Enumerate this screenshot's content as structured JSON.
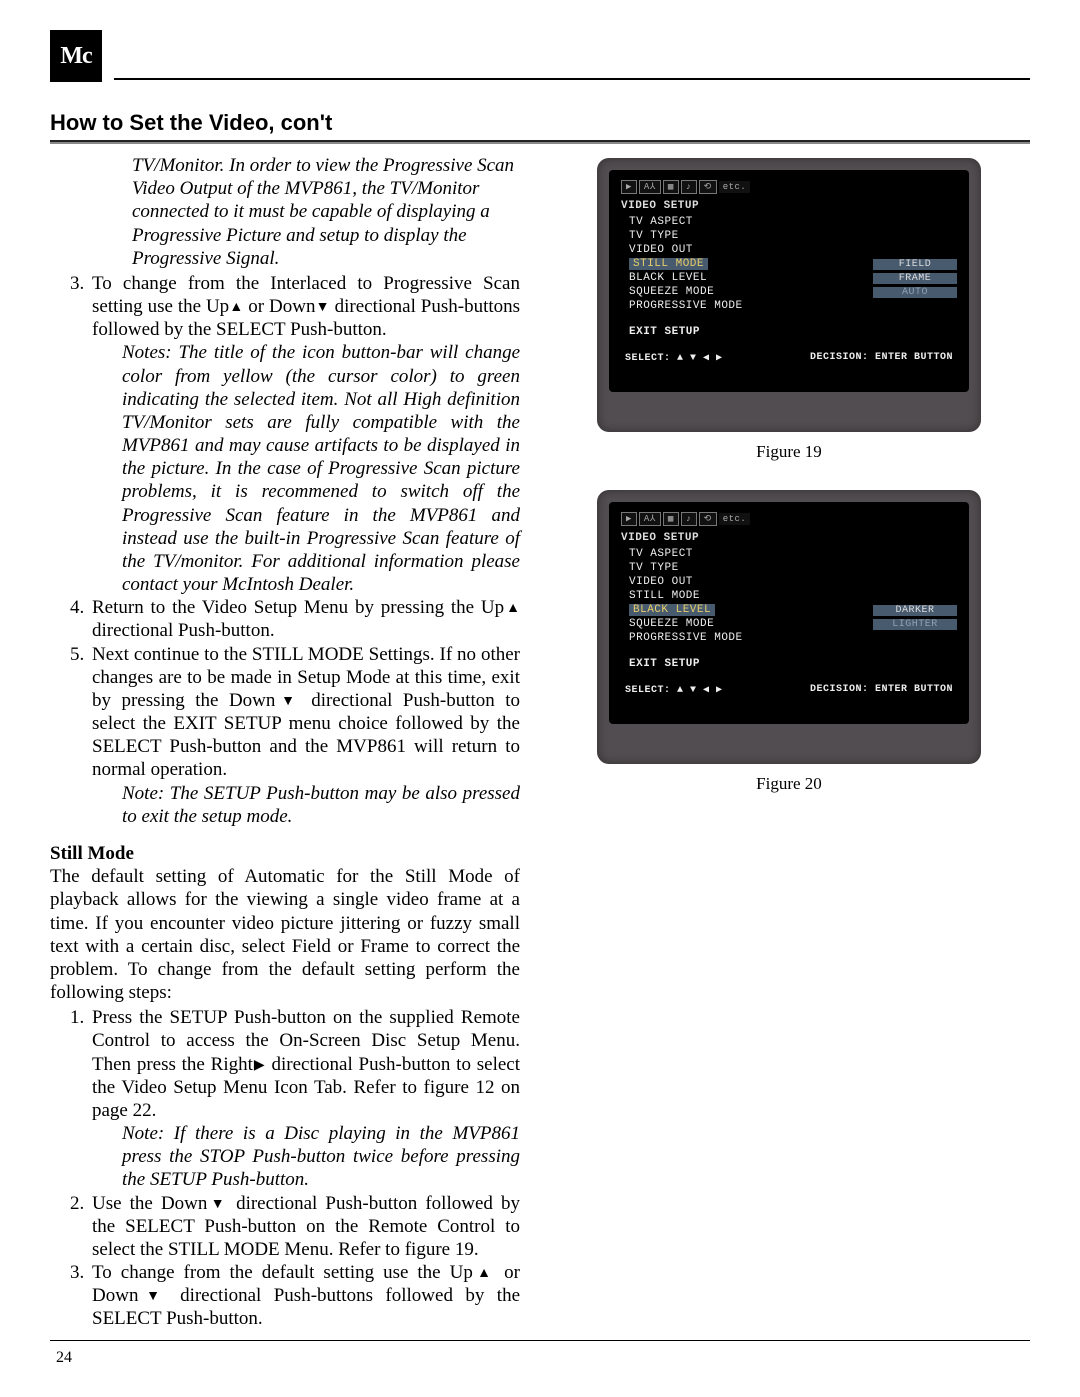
{
  "header": {
    "logo_text": "Mc"
  },
  "section_title": "How to Set the Video, con't",
  "intro_note": "TV/Monitor. In order to view the Progressive Scan Video Output of the MVP861, the TV/Monitor connected to it must be capable of displaying a Progressive Picture and setup to display the Progressive Signal.",
  "step3_num": "3.",
  "step3_body_a": "To change from the Interlaced to Progressive Scan setting use the Up",
  "step3_body_b": " or Down",
  "step3_body_c": " directional Push-buttons followed by the SELECT Push-button.",
  "step3_notes_label": "Notes:",
  "step3_notes_body": " The title of the icon button-bar will change color from yellow (the cursor color) to green indicating the selected item. Not all High definition TV/Monitor sets are fully compatible with the MVP861 and may cause artifacts to be displayed in the picture. In the case of Progressive Scan picture problems, it is recommened to switch off the Progressive Scan feature in the MVP861 and instead use the built-in Progressive Scan feature of the TV/monitor. For additional information please contact your McIntosh Dealer.",
  "step4_num": "4.",
  "step4_body_a": "Return to the Video Setup Menu by pressing the Up",
  "step4_body_b": " directional Push-button.",
  "step5_num": "5.",
  "step5_body_a": "Next continue to the STILL MODE Settings. If no other changes are to be made in Setup Mode at this time, exit by pressing the Down",
  "step5_body_b": " directional Push-button to select the EXIT SETUP menu choice followed by the SELECT Push-button and the MVP861 will return to normal operation.",
  "step5_note_label": "Note:",
  "step5_note_body": " The SETUP Push-button may be also pressed to exit the setup mode.",
  "still_mode_heading": "Still Mode",
  "still_mode_intro": "The default setting of Automatic for the Still Mode of playback allows for the viewing a single video frame at a time. If you encounter video picture jittering or fuzzy small text with a certain disc, select Field or Frame to correct the problem. To change from the default setting perform the following steps:",
  "sm1_num": "1.",
  "sm1_body_a": "Press the SETUP Push-button on the supplied Remote Control to access the On-Screen Disc Setup Menu. Then press the Right",
  "sm1_body_b": " directional Push-button to select the Video Setup Menu Icon Tab. Refer to figure 12 on page 22.",
  "sm1_note_label": "Note:",
  "sm1_note_body": " If there is a Disc playing in the MVP861 press the STOP Push-button twice before pressing the SETUP Push-button.",
  "sm2_num": "2.",
  "sm2_body_a": "Use the Down",
  "sm2_body_b": " directional Push-button followed by the SELECT Push-button on the Remote Control to select the STILL MODE Menu. Refer to figure 19.",
  "sm3_num": "3.",
  "sm3_body_a": "To change from the default setting use the Up",
  "sm3_body_b": " or Down",
  "sm3_body_c": " directional Push-buttons followed by the SELECT Push-button.",
  "page_number": "24",
  "figures": {
    "fig19": {
      "caption": "Figure 19",
      "icons": [
        "▶",
        "A⅄",
        "▦",
        "♪",
        "⟲",
        "etc."
      ],
      "title": "VIDEO SETUP",
      "items": [
        "TV ASPECT",
        "TV TYPE",
        "VIDEO OUT",
        "STILL MODE",
        "BLACK LEVEL",
        "SQUEEZE MODE",
        "PROGRESSIVE MODE"
      ],
      "highlight_index": 3,
      "options": [
        "FIELD",
        "FRAME",
        "AUTO"
      ],
      "option_dim_index": 2,
      "exit": "EXIT SETUP",
      "select_left": "SELECT: ▲ ▼ ◀ ▶",
      "select_right": "DECISION: ENTER BUTTON"
    },
    "fig20": {
      "caption": "Figure 20",
      "icons": [
        "▶",
        "A⅄",
        "▦",
        "♪",
        "⟲",
        "etc."
      ],
      "title": "VIDEO SETUP",
      "items": [
        "TV ASPECT",
        "TV TYPE",
        "VIDEO OUT",
        "STILL MODE",
        "BLACK LEVEL",
        "SQUEEZE MODE",
        "PROGRESSIVE MODE"
      ],
      "highlight_index": 4,
      "options": [
        "DARKER",
        "LIGHTER"
      ],
      "option_dim_index": 1,
      "exit": "EXIT SETUP",
      "select_left": "SELECT: ▲ ▼ ◀ ▶",
      "select_right": "DECISION: ENTER BUTTON"
    }
  },
  "glyphs": {
    "up": "▲",
    "down": "▼",
    "right": "▶"
  }
}
